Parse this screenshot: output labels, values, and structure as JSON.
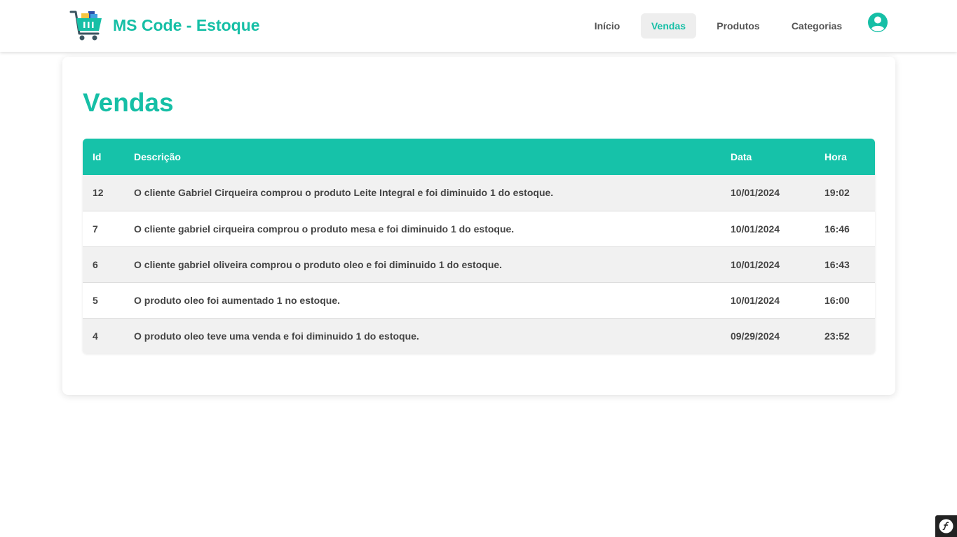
{
  "header": {
    "brand_title": "MS Code - Estoque",
    "logo_icon": "shopping-cart-icon",
    "account_icon": "user-circle-icon",
    "nav": [
      {
        "label": "Início",
        "active": false
      },
      {
        "label": "Vendas",
        "active": true
      },
      {
        "label": "Produtos",
        "active": false
      },
      {
        "label": "Categorias",
        "active": false
      }
    ]
  },
  "main": {
    "title": "Vendas",
    "columns": {
      "id": "Id",
      "desc": "Descrição",
      "data": "Data",
      "hora": "Hora"
    },
    "rows": [
      {
        "id": "12",
        "desc": "O cliente Gabriel Cirqueira comprou o produto Leite Integral e foi diminuido 1 do estoque.",
        "data": "10/01/2024",
        "hora": "19:02"
      },
      {
        "id": "7",
        "desc": "O cliente gabriel cirqueira comprou o produto mesa e foi diminuido 1 do estoque.",
        "data": "10/01/2024",
        "hora": "16:46"
      },
      {
        "id": "6",
        "desc": "O cliente gabriel oliveira comprou o produto oleo e foi diminuido 1 do estoque.",
        "data": "10/01/2024",
        "hora": "16:43"
      },
      {
        "id": "5",
        "desc": "O produto oleo foi aumentado 1 no estoque.",
        "data": "10/01/2024",
        "hora": "16:00"
      },
      {
        "id": "4",
        "desc": "O produto oleo teve uma venda e foi diminuido 1 do estoque.",
        "data": "09/29/2024",
        "hora": "23:52"
      }
    ]
  },
  "debug_toolbar": {
    "icon": "symfony-icon"
  },
  "colors": {
    "accent": "#16bfa6",
    "table_header": "#16c2a9",
    "row_alt": "#f1f1f1"
  }
}
